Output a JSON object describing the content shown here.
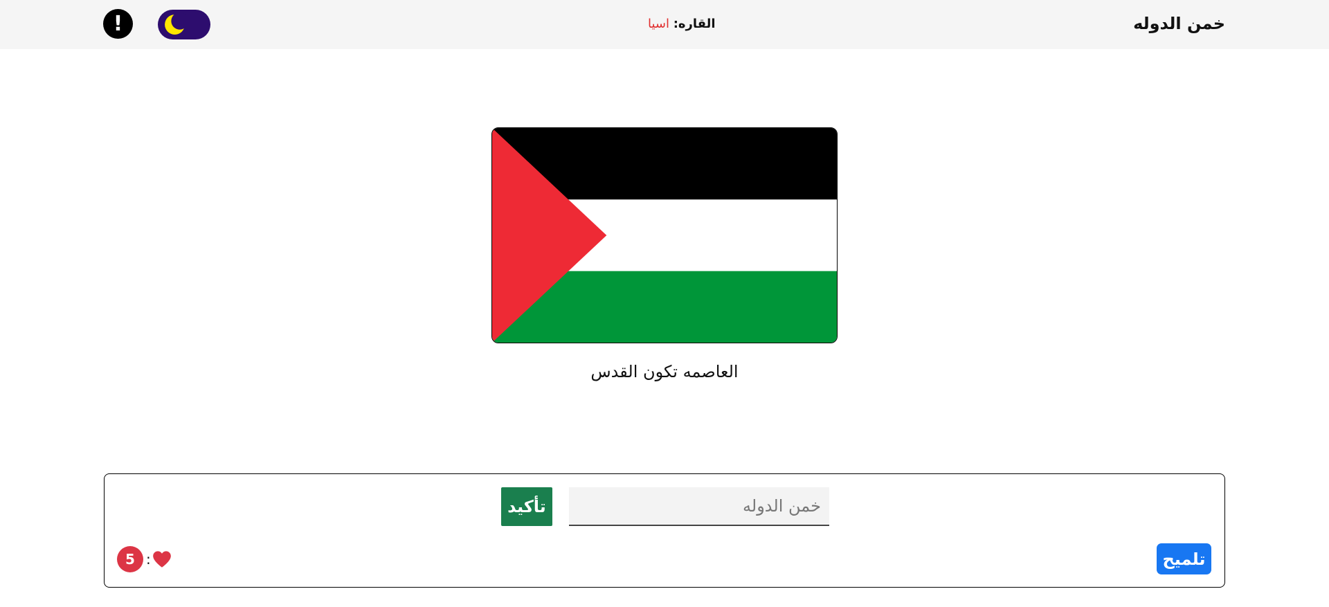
{
  "header": {
    "title": "خمن الدوله",
    "continent_label": "القاره:",
    "continent_value": "اسيا",
    "info_symbol": "!",
    "icons": {
      "theme_toggle": "moon-icon",
      "info": "exclamation-icon"
    }
  },
  "flag": {
    "country_flag": "palestine-flag",
    "colors": {
      "top": "#000000",
      "middle": "#ffffff",
      "bottom": "#009639",
      "triangle": "#ee2a35"
    }
  },
  "clue": {
    "text": "العاصمه تكون القدس"
  },
  "guess_panel": {
    "input_placeholder": "خمن الدوله",
    "input_value": "",
    "confirm_label": "تأكيد",
    "hint_label": "تلميح",
    "lives_count": "5",
    "lives_separator": ":",
    "lives_icon": "heart-icon"
  },
  "colors": {
    "confirm_button": "#1a7f4e",
    "hint_button": "#1877f2",
    "lives_badge": "#dc3545",
    "continent_value": "#e02e2e",
    "toggle_bg": "#2d0d6e",
    "moon": "#ffe600"
  }
}
